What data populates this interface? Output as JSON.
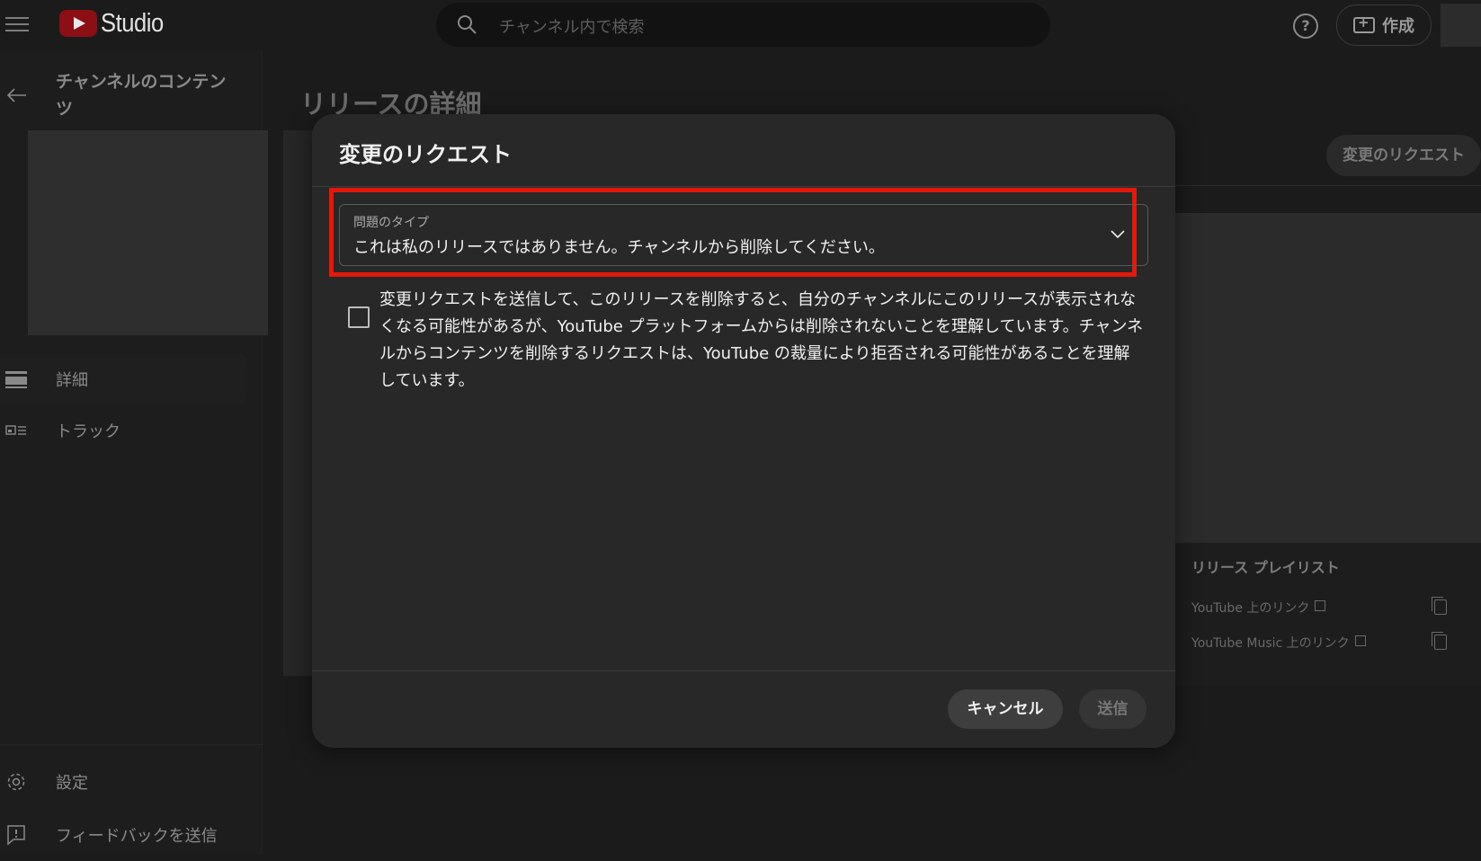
{
  "header": {
    "logo_text": "Studio",
    "search_placeholder": "チャンネル内で検索",
    "help_label": "?",
    "create_label": "作成"
  },
  "sidebar": {
    "channel_title": "チャンネルのコンテンツ",
    "items": [
      {
        "label": "詳細",
        "icon": "details-icon",
        "active": true
      },
      {
        "label": "トラック",
        "icon": "tracks-icon",
        "active": false
      }
    ],
    "bottom_items": [
      {
        "label": "設定",
        "icon": "gear-icon"
      },
      {
        "label": "フィードバックを送信",
        "icon": "feedback-icon"
      }
    ]
  },
  "page": {
    "title": "リリースの詳細",
    "request_change_label": "変更のリクエスト",
    "playlist": {
      "title": "リリース プレイリスト",
      "youtube_link_label": "YouTube 上のリンク",
      "youtube_music_link_label": "YouTube Music 上のリンク"
    }
  },
  "modal": {
    "title": "変更のリクエスト",
    "issue_type_label": "問題のタイプ",
    "issue_type_value": "これは私のリリースではありません。チャンネルから削除してください。",
    "acknowledgement": "変更リクエストを送信して、このリリースを削除すると、自分のチャンネルにこのリリースが表示されなくなる可能性があるが、YouTube プラットフォームからは削除されないことを理解しています。チャンネルからコンテンツを削除するリクエストは、YouTube の裁量により拒否される可能性があることを理解しています。",
    "acknowledgement_checked": false,
    "cancel_label": "キャンセル",
    "submit_label": "送信"
  },
  "colors": {
    "background": "#1b1b1b",
    "modal": "#282828",
    "highlight": "#e3180c",
    "brand_red": "#8b0f14"
  }
}
